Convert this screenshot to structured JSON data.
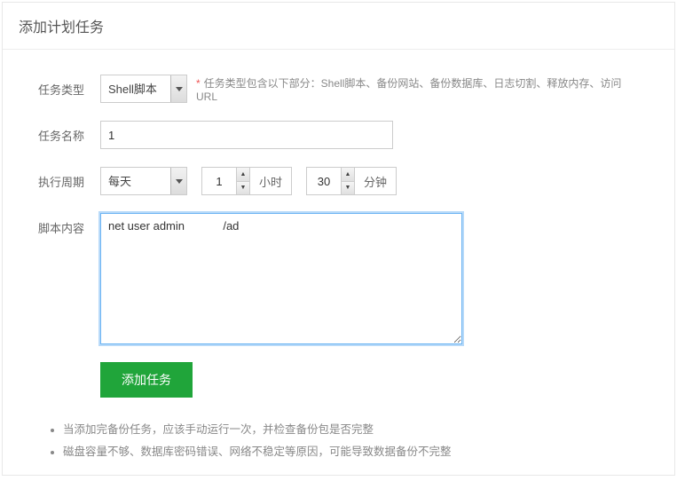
{
  "panel": {
    "title": "添加计划任务"
  },
  "labels": {
    "task_type": "任务类型",
    "task_name": "任务名称",
    "cycle": "执行周期",
    "script": "脚本内容"
  },
  "task_type": {
    "selected": "Shell脚本",
    "hint_prefix": "*",
    "hint": "任务类型包含以下部分：Shell脚本、备份网站、备份数据库、日志切割、释放内存、访问URL"
  },
  "task_name": {
    "value": "1"
  },
  "cycle": {
    "period": "每天",
    "hour": "1",
    "hour_unit": "小时",
    "minute": "30",
    "minute_unit": "分钟"
  },
  "script": {
    "prefix": "net user admin",
    "suffix": "/ad"
  },
  "submit": {
    "label": "添加任务"
  },
  "notes": {
    "n1": "当添加完备份任务，应该手动运行一次，并检查备份包是否完整",
    "n2": "磁盘容量不够、数据库密码错误、网络不稳定等原因，可能导致数据备份不完整"
  }
}
